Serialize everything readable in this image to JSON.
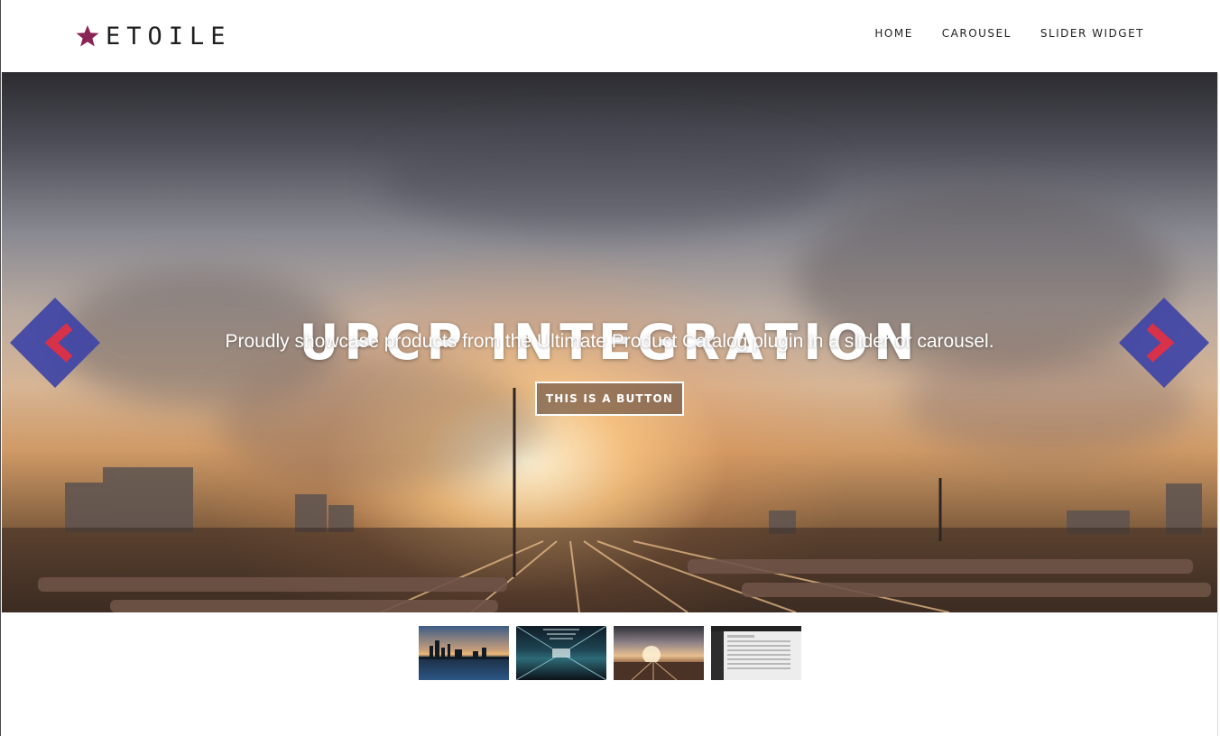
{
  "brand": {
    "name": "ETOILE",
    "star_color": "#8b2456"
  },
  "nav": {
    "items": [
      {
        "label": "HOME"
      },
      {
        "label": "CAROUSEL"
      },
      {
        "label": "SLIDER WIDGET"
      }
    ]
  },
  "slider": {
    "title": "UPCP INTEGRATION",
    "subtitle": "Proudly showcase products from the Ultimate Product Catalog plugin in a slider or carousel.",
    "button_label": "THIS IS A BUTTON",
    "prev_icon": "chevron-left-icon",
    "next_icon": "chevron-right-icon",
    "arrow_fill": "#3f44a6",
    "arrow_chevron": "#d8314a",
    "thumbnails": [
      {
        "name": "city-skyline-thumbnail"
      },
      {
        "name": "station-tunnel-thumbnail"
      },
      {
        "name": "rail-yard-sunset-thumbnail"
      },
      {
        "name": "admin-screenshot-thumbnail"
      }
    ]
  }
}
